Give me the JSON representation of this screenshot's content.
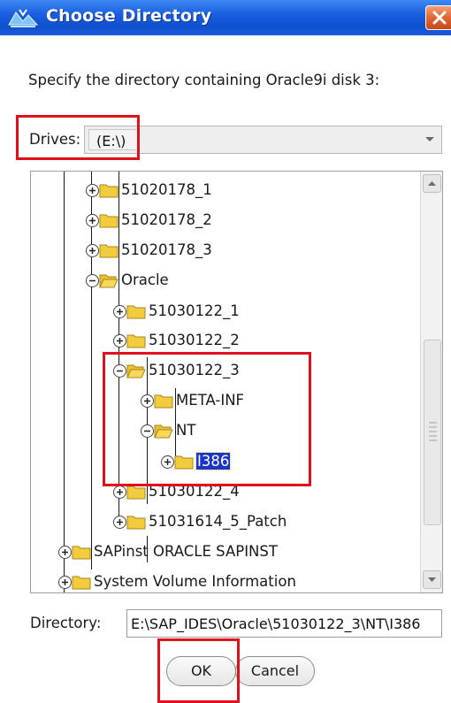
{
  "window": {
    "title": "Choose Directory"
  },
  "prompt": "Specify the directory containing Oracle9i disk 3:",
  "drives": {
    "label": "Drives:",
    "value": "(E:\\)"
  },
  "tree": [
    {
      "label": "51020178_1",
      "expanded": false
    },
    {
      "label": "51020178_2",
      "expanded": false
    },
    {
      "label": "51020178_3",
      "expanded": false
    },
    {
      "label": "Oracle",
      "expanded": true
    },
    {
      "label": "51030122_1",
      "expanded": false
    },
    {
      "label": "51030122_2",
      "expanded": false
    },
    {
      "label": "51030122_3",
      "expanded": true
    },
    {
      "label": "META-INF",
      "expanded": false
    },
    {
      "label": "NT",
      "expanded": true
    },
    {
      "label": "I386",
      "expanded": false,
      "selected": true
    },
    {
      "label": "51030122_4",
      "expanded": false
    },
    {
      "label": "51031614_5_Patch",
      "expanded": false
    },
    {
      "label": "SAPinst ORACLE SAPINST",
      "expanded": false
    },
    {
      "label": "System Volume Information",
      "expanded": false
    }
  ],
  "directory": {
    "label": "Directory:",
    "value": "E:\\SAP_IDES\\Oracle\\51030122_3\\NT\\I386"
  },
  "buttons": {
    "ok": "OK",
    "cancel": "Cancel"
  },
  "colors": {
    "titlebar": "#0f4fcf",
    "selection": "#1c35c9",
    "highlight_box": "#e0101c",
    "folder": "#f2cc3d"
  }
}
